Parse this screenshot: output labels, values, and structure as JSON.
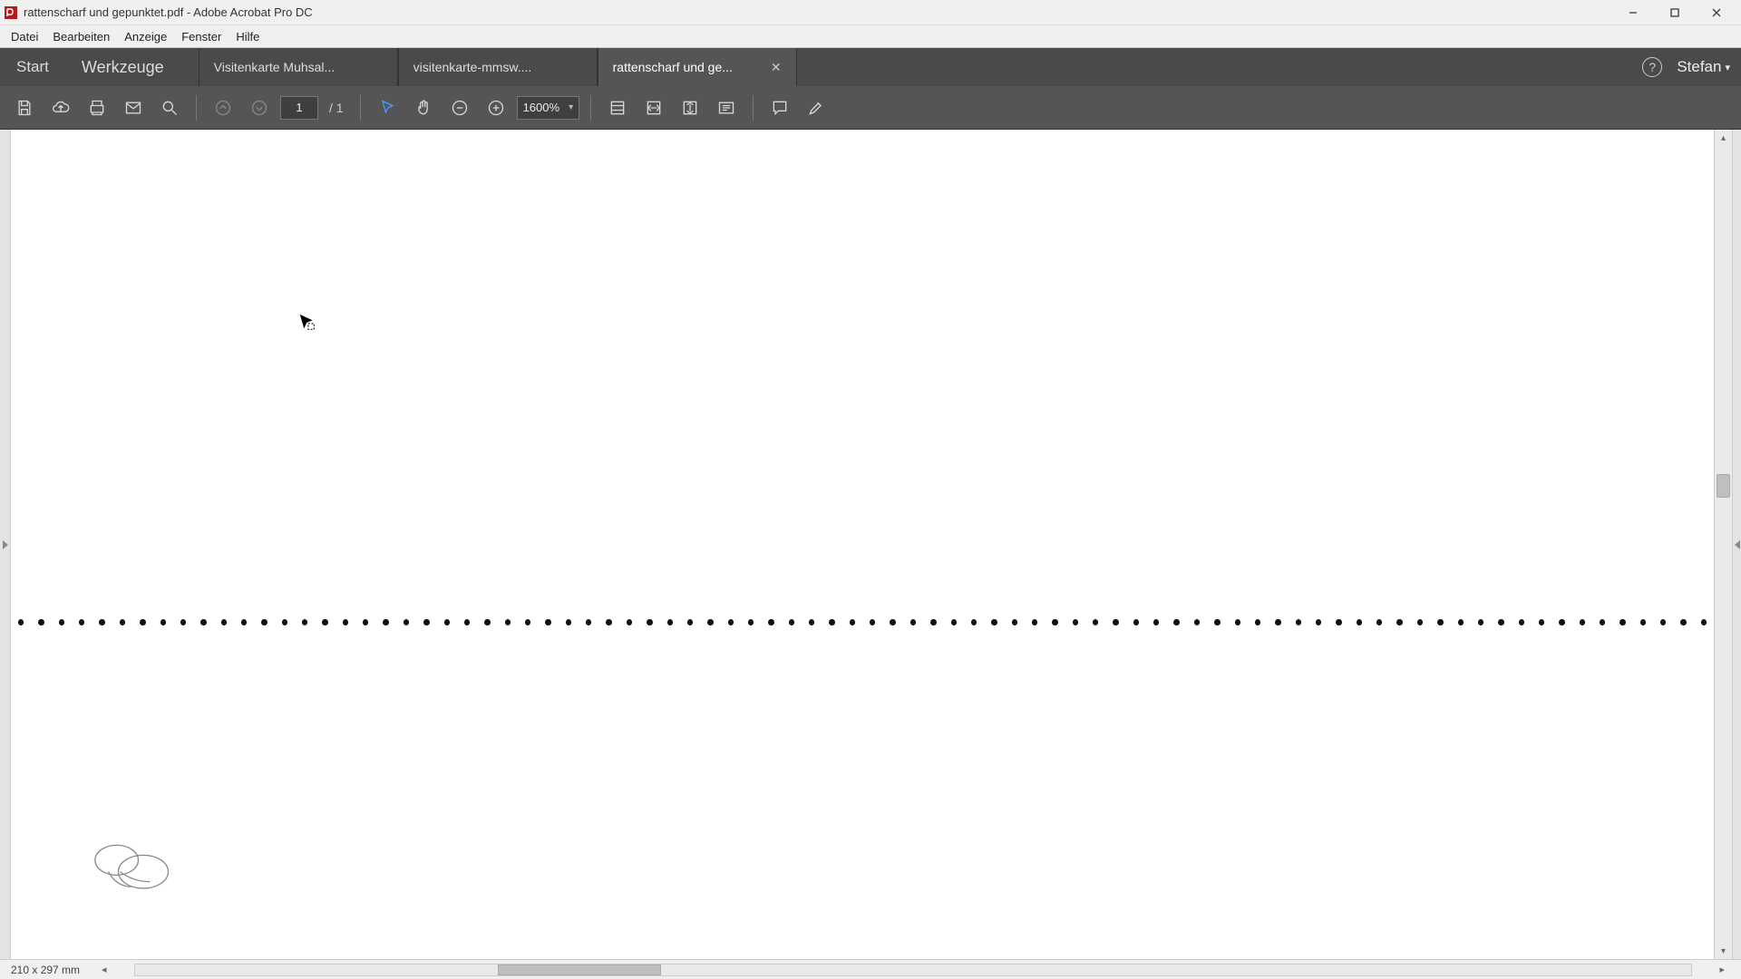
{
  "window": {
    "title": "rattenscharf und gepunktet.pdf - Adobe Acrobat Pro DC"
  },
  "menubar": {
    "datei": "Datei",
    "bearbeiten": "Bearbeiten",
    "anzeige": "Anzeige",
    "fenster": "Fenster",
    "hilfe": "Hilfe"
  },
  "tabs": {
    "start": "Start",
    "tools": "Werkzeuge",
    "docs": [
      {
        "label": "Visitenkarte Muhsal..."
      },
      {
        "label": "visitenkarte-mmsw...."
      },
      {
        "label": "rattenscharf und ge..."
      }
    ]
  },
  "user": {
    "name": "Stefan"
  },
  "paging": {
    "current": "1",
    "total": "/ 1"
  },
  "zoom": {
    "value": "1600%"
  },
  "status": {
    "dimensions": "210 x 297 mm"
  }
}
